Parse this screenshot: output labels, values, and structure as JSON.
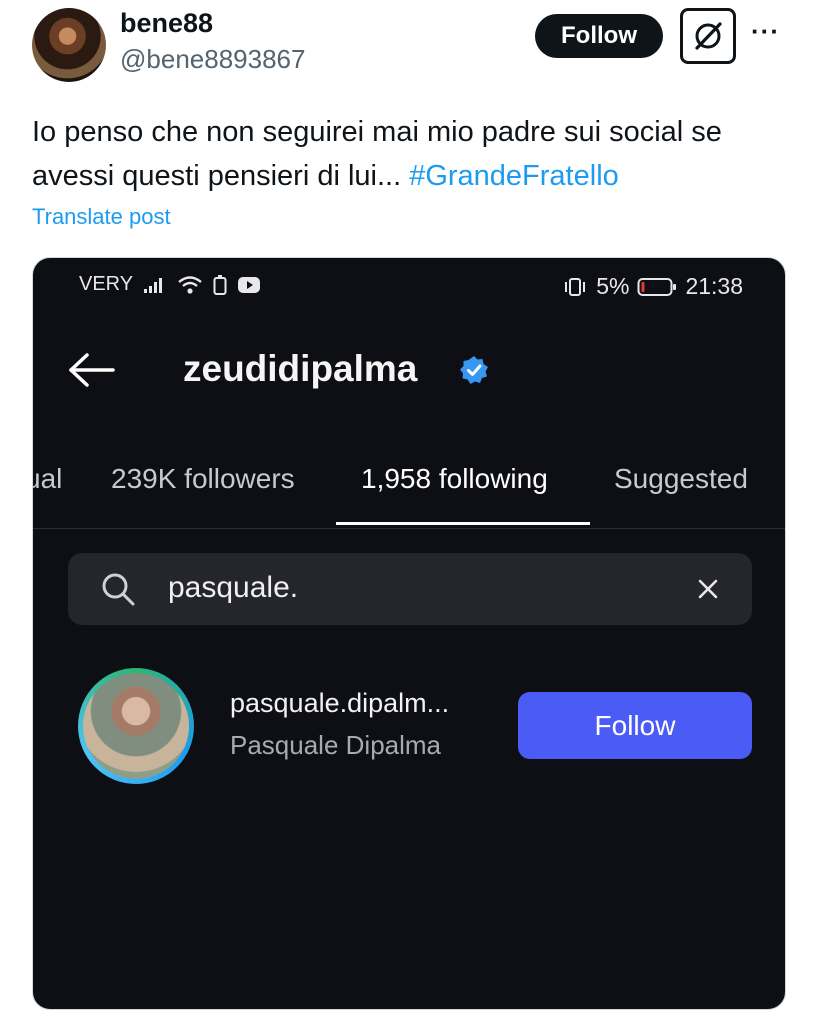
{
  "tweet": {
    "display_name": "bene88",
    "handle": "@bene8893867",
    "follow_label": "Follow",
    "more_label": "···",
    "text": "Io penso che non seguirei mai mio padre sui social se avessi questi pensieri di lui...",
    "hashtag": "#GrandeFratello",
    "translate_label": "Translate post"
  },
  "phone": {
    "status_bar": {
      "carrier": "VERY",
      "battery": "5%",
      "time": "21:38"
    },
    "profile": {
      "username": "zeudidipalma",
      "verified": true
    },
    "tabs": [
      {
        "label": "ual",
        "active": false
      },
      {
        "label": "239K followers",
        "active": false
      },
      {
        "label": "1,958 following",
        "active": true
      },
      {
        "label": "Suggested",
        "active": false
      }
    ],
    "search": {
      "value": "pasquale."
    },
    "result": {
      "username": "pasquale.dipalm...",
      "full_name": "Pasquale Dipalma",
      "follow_label": "Follow"
    }
  },
  "colors": {
    "link_blue": "#1d9bf0",
    "ig_follow": "#4a5cf5",
    "ig_background": "#0e0f14"
  }
}
